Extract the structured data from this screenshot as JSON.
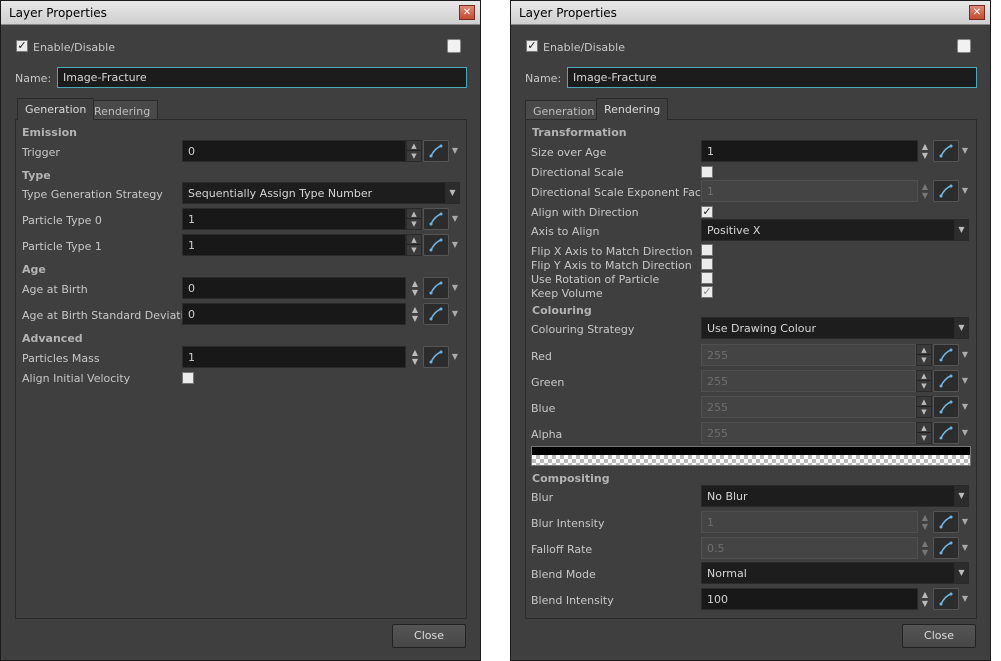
{
  "left": {
    "title": "Layer Properties",
    "close_x": "✕",
    "enable_label": "Enable/Disable",
    "name_label": "Name:",
    "name_value": "Image-Fracture",
    "tabs": [
      "Generation",
      "Rendering"
    ],
    "sections": {
      "emission": "Emission",
      "type": "Type",
      "age": "Age",
      "advanced": "Advanced"
    },
    "rows": {
      "trigger": {
        "label": "Trigger",
        "value": "0"
      },
      "type_strategy": {
        "label": "Type Generation Strategy",
        "value": "Sequentially Assign Type Number"
      },
      "ptype0": {
        "label": "Particle Type 0",
        "value": "1"
      },
      "ptype1": {
        "label": "Particle Type 1",
        "value": "1"
      },
      "age_birth": {
        "label": "Age at Birth",
        "value": "0"
      },
      "age_std": {
        "label": "Age at Birth Standard Deviation",
        "value": "0"
      },
      "mass": {
        "label": "Particles Mass",
        "value": "1"
      },
      "align_vel": {
        "label": "Align Initial Velocity",
        "checked": false
      }
    },
    "close_label": "Close"
  },
  "right": {
    "title": "Layer Properties",
    "close_x": "✕",
    "enable_label": "Enable/Disable",
    "name_label": "Name:",
    "name_value": "Image-Fracture",
    "tabs": [
      "Generation",
      "Rendering"
    ],
    "sections": {
      "transformation": "Transformation",
      "colouring": "Colouring",
      "compositing": "Compositing"
    },
    "rows": {
      "size_age": {
        "label": "Size over Age",
        "value": "1"
      },
      "dir_scale": {
        "label": "Directional Scale",
        "checked": false
      },
      "dir_exp": {
        "label": "Directional Scale Exponent Factor",
        "value": "1"
      },
      "align_dir": {
        "label": "Align with Direction",
        "checked": true
      },
      "axis_align": {
        "label": "Axis to Align",
        "value": "Positive X"
      },
      "flip_x": {
        "label": "Flip X Axis to Match Direction",
        "checked": false
      },
      "flip_y": {
        "label": "Flip Y Axis to Match Direction",
        "checked": false
      },
      "use_rot": {
        "label": "Use Rotation of Particle",
        "checked": false
      },
      "keep_vol": {
        "label": "Keep Volume",
        "checked": true
      },
      "col_strategy": {
        "label": "Colouring Strategy",
        "value": "Use Drawing Colour"
      },
      "red": {
        "label": "Red",
        "value": "255"
      },
      "green": {
        "label": "Green",
        "value": "255"
      },
      "blue": {
        "label": "Blue",
        "value": "255"
      },
      "alpha": {
        "label": "Alpha",
        "value": "255"
      },
      "blur": {
        "label": "Blur",
        "value": "No Blur"
      },
      "blur_int": {
        "label": "Blur Intensity",
        "value": "1"
      },
      "falloff": {
        "label": "Falloff Rate",
        "value": "0.5"
      },
      "blend_mode": {
        "label": "Blend Mode",
        "value": "Normal"
      },
      "blend_int": {
        "label": "Blend Intensity",
        "value": "100"
      }
    },
    "close_label": "Close"
  },
  "icons": {
    "enable_checked": "✓",
    "spin_up": "▲",
    "spin_down": "▼",
    "dropdown_arrow": "▼",
    "function_icon": "function-curve-icon"
  },
  "colors": {
    "window_bg": "#3f3f3f",
    "field_bg": "#181818",
    "accent": "#4aa9b5",
    "titlebar": "#d8d8d8"
  }
}
